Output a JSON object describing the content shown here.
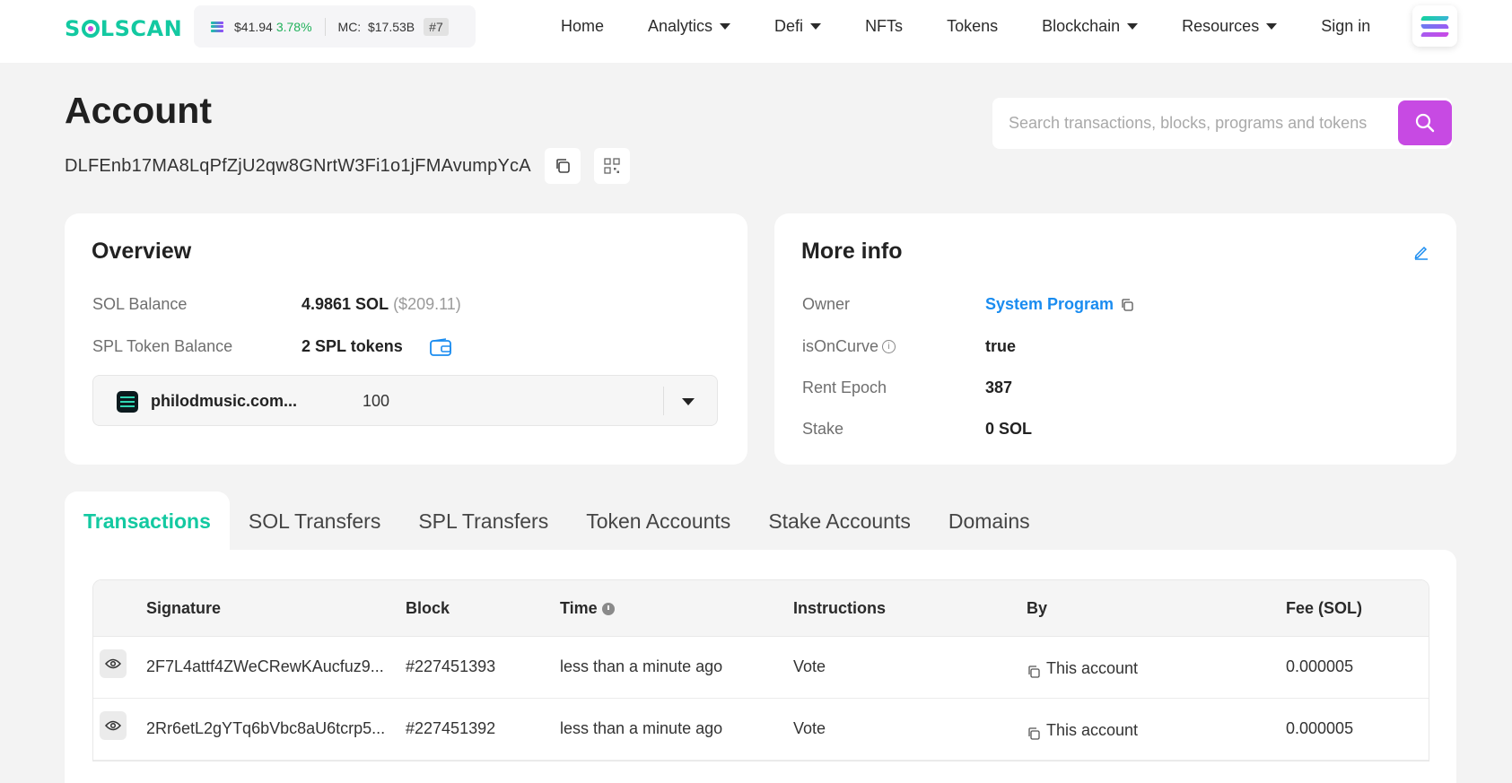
{
  "brand": {
    "logo_text_pre": "S",
    "logo_text_post": "LSCAN"
  },
  "ticker": {
    "price": "$41.94",
    "change": "3.78%",
    "mc_label": "MC:",
    "mc_value": "$17.53B",
    "rank": "#7"
  },
  "nav": {
    "items": [
      {
        "label": "Home",
        "dropdown": false
      },
      {
        "label": "Analytics",
        "dropdown": true
      },
      {
        "label": "Defi",
        "dropdown": true
      },
      {
        "label": "NFTs",
        "dropdown": false
      },
      {
        "label": "Tokens",
        "dropdown": false
      },
      {
        "label": "Blockchain",
        "dropdown": true
      },
      {
        "label": "Resources",
        "dropdown": true
      },
      {
        "label": "Sign in",
        "dropdown": false
      }
    ]
  },
  "header": {
    "title": "Account",
    "address": "DLFEnb17MA8LqPfZjU2qw8GNrtW3Fi1o1jFMAvumpYcA"
  },
  "search": {
    "placeholder": "Search transactions, blocks, programs and tokens"
  },
  "overview": {
    "title": "Overview",
    "sol_balance_label": "SOL Balance",
    "sol_balance_value": "4.9861 SOL",
    "sol_balance_usd": "($209.11)",
    "spl_label": "SPL Token Balance",
    "spl_value": "2 SPL tokens",
    "token": {
      "name": "philodmusic.com...",
      "amount": "100"
    }
  },
  "more_info": {
    "title": "More info",
    "owner_label": "Owner",
    "owner_value": "System Program",
    "curve_label": "isOnCurve",
    "curve_value": "true",
    "rent_label": "Rent Epoch",
    "rent_value": "387",
    "stake_label": "Stake",
    "stake_value": "0 SOL"
  },
  "tabs": [
    "Transactions",
    "SOL Transfers",
    "SPL Transfers",
    "Token Accounts",
    "Stake Accounts",
    "Domains"
  ],
  "table": {
    "columns": [
      "Signature",
      "Block",
      "Time",
      "Instructions",
      "By",
      "Fee (SOL)"
    ],
    "rows": [
      {
        "signature": "2F7L4attf4ZWeCRewKAucfuz9...",
        "block": "#227451393",
        "time": "less than a minute ago",
        "instructions": "Vote",
        "by": "This account",
        "fee": "0.000005"
      },
      {
        "signature": "2Rr6etL2gYTq6bVbc8aU6tcrp5...",
        "block": "#227451392",
        "time": "less than a minute ago",
        "instructions": "Vote",
        "by": "This account",
        "fee": "0.000005"
      }
    ]
  },
  "colors": {
    "brand_green": "#13c9a1",
    "accent_purple": "#c74ae3",
    "link_blue": "#1a8cf0"
  }
}
